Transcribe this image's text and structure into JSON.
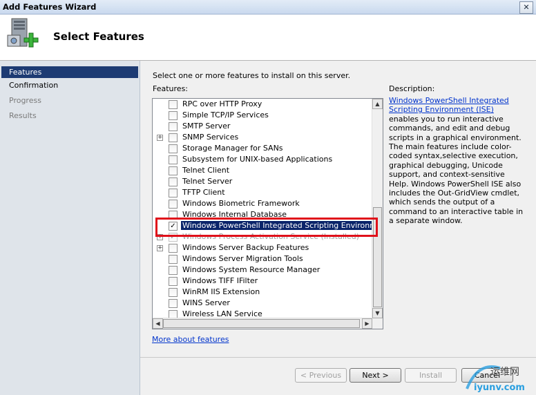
{
  "window": {
    "title": "Add Features Wizard",
    "close_glyph": "✕"
  },
  "header": {
    "title": "Select Features",
    "icon": "server-add-icon"
  },
  "nav": {
    "items": [
      {
        "label": "Features",
        "state": "active"
      },
      {
        "label": "Confirmation",
        "state": "normal"
      },
      {
        "label": "Progress",
        "state": "disabled"
      },
      {
        "label": "Results",
        "state": "disabled"
      }
    ]
  },
  "main": {
    "intro": "Select one or more features to install on this server.",
    "features_label": "Features:",
    "features": [
      {
        "label": "RPC over HTTP Proxy",
        "checked": false,
        "expand": false
      },
      {
        "label": "Simple TCP/IP Services",
        "checked": false,
        "expand": false
      },
      {
        "label": "SMTP Server",
        "checked": false,
        "expand": false
      },
      {
        "label": "SNMP Services",
        "checked": false,
        "expand": true
      },
      {
        "label": "Storage Manager for SANs",
        "checked": false,
        "expand": false
      },
      {
        "label": "Subsystem for UNIX-based Applications",
        "checked": false,
        "expand": false
      },
      {
        "label": "Telnet Client",
        "checked": false,
        "expand": false
      },
      {
        "label": "Telnet Server",
        "checked": false,
        "expand": false
      },
      {
        "label": "TFTP Client",
        "checked": false,
        "expand": false
      },
      {
        "label": "Windows Biometric Framework",
        "checked": false,
        "expand": false
      },
      {
        "label": "Windows Internal Database",
        "checked": false,
        "expand": false
      },
      {
        "label": "Windows PowerShell Integrated Scripting Environment (IS",
        "checked": true,
        "expand": false,
        "selected": true
      },
      {
        "label": "Windows Process Activation Service  (Installed)",
        "checked": true,
        "expand": true,
        "dim": true
      },
      {
        "label": "Windows Server Backup Features",
        "checked": false,
        "expand": true
      },
      {
        "label": "Windows Server Migration Tools",
        "checked": false,
        "expand": false
      },
      {
        "label": "Windows System Resource Manager",
        "checked": false,
        "expand": false
      },
      {
        "label": "Windows TIFF IFilter",
        "checked": false,
        "expand": false
      },
      {
        "label": "WinRM IIS Extension",
        "checked": false,
        "expand": false
      },
      {
        "label": "WINS Server",
        "checked": false,
        "expand": false
      },
      {
        "label": "Wireless LAN Service",
        "checked": false,
        "expand": false
      }
    ],
    "more_link": "More about features"
  },
  "description": {
    "label": "Description:",
    "link": "Windows PowerShell Integrated Scripting Environment (ISE)",
    "text": " enables you to run interactive commands, and edit and debug scripts in a graphical environment. The main features include color-coded syntax,selective execution, graphical debugging, Unicode support, and context-sensitive Help. Windows PowerShell ISE also includes the Out-GridView cmdlet, which sends the output of a command to an interactive table in a separate window."
  },
  "buttons": {
    "previous": "< Previous",
    "next": "Next >",
    "install": "Install",
    "cancel": "Cancel"
  },
  "watermark": {
    "cn": "运维网",
    "url": "iyunv.com"
  },
  "colors": {
    "nav_active": "#1d3b73",
    "selection": "#0a246a",
    "highlight_box": "#e0101a",
    "link": "#0033cc"
  }
}
